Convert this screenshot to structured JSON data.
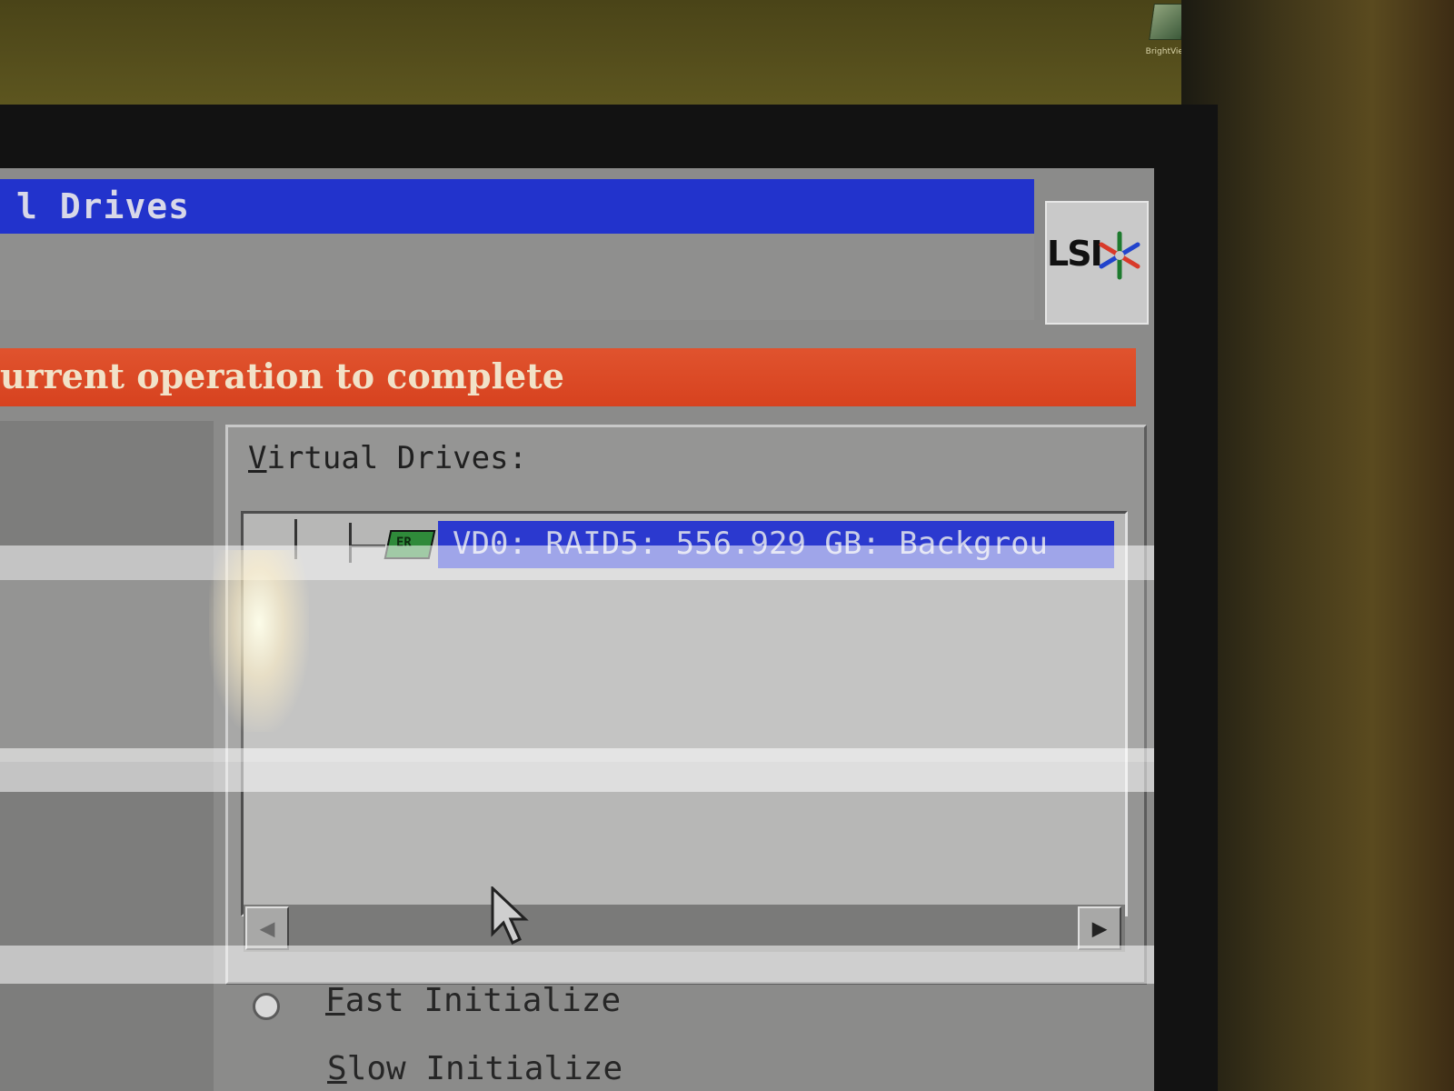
{
  "desktop_icon": {
    "name": "desktop-shortcut-icon",
    "caption": "BrightView"
  },
  "header": {
    "title": "l Drives",
    "logo_text": "LSI"
  },
  "banner": {
    "text": "urrent operation to complete",
    "color": "#d7421f"
  },
  "virtual_drives": {
    "label_first": "V",
    "label_rest": "irtual Drives:",
    "items": [
      {
        "label": "VD0: RAID5: 556.929 GB: Backgrou",
        "selected": true
      }
    ],
    "drive_icon_text": "ER"
  },
  "scrollbar": {
    "left_arrow": "◀",
    "right_arrow": "▶"
  },
  "init_options": {
    "fast_first": "F",
    "fast_rest": "ast Initialize",
    "slow_first": "S",
    "slow_rest": "low Initialize"
  },
  "colors": {
    "title_bar": "#2233cc",
    "selection": "#2b39cf",
    "panel_gray": "#8b8b8a"
  }
}
